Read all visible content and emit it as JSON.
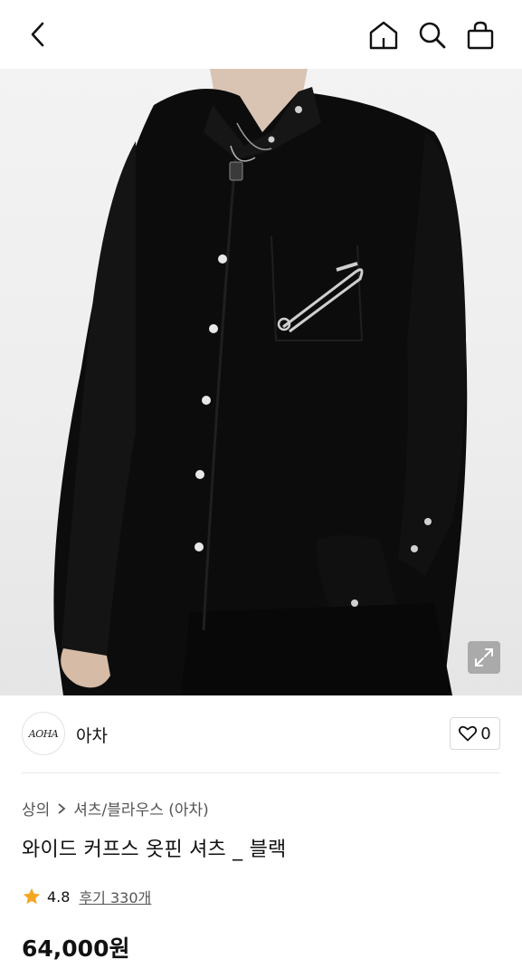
{
  "header": {
    "icons": [
      "chevron-left-icon",
      "home-icon",
      "search-icon",
      "shopping-bag-icon"
    ]
  },
  "product": {
    "image_alt": "black wide-cuff shirt with safety pin",
    "brand": {
      "logo_text": "AOHA",
      "name": "아차"
    },
    "likes": "0",
    "breadcrumb": {
      "category": "상의",
      "subcategory": "셔츠/블라우스 (아차)"
    },
    "title": "와이드 커프스 옷핀 셔츠 _ 블랙",
    "rating": "4.8",
    "review_text": "후기 330개",
    "price": "64,000원"
  },
  "colors": {
    "star": "#F5A623",
    "shirt": "#0c0c0c",
    "background": "#ffffff"
  }
}
